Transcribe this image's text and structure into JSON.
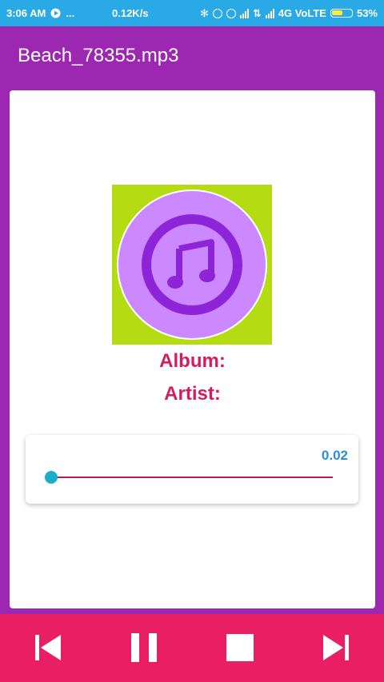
{
  "status_bar": {
    "time": "3:06 AM",
    "overflow": "...",
    "net_speed": "0.12K/s",
    "network": "4G VoLTE",
    "battery": "53%"
  },
  "toolbar": {
    "title": "Beach_78355.mp3"
  },
  "track": {
    "album_label": "Album:",
    "artist_label": "Artist:"
  },
  "seek": {
    "value_text": "0.02",
    "position_fraction": 0.0
  },
  "colors": {
    "primary": "#9c27b0",
    "accent": "#e91e63",
    "status_bar": "#29a9e6",
    "art_background": "#b5dc13",
    "art_circle": "#cc88ff",
    "art_ring": "#8e24d8",
    "label": "#d81b60",
    "seek_value": "#2b8fd6",
    "thumb": "#1cb0c8"
  },
  "controls": {
    "previous_icon": "skip-previous-icon",
    "pause_icon": "pause-icon",
    "stop_icon": "stop-icon",
    "next_icon": "skip-next-icon"
  }
}
